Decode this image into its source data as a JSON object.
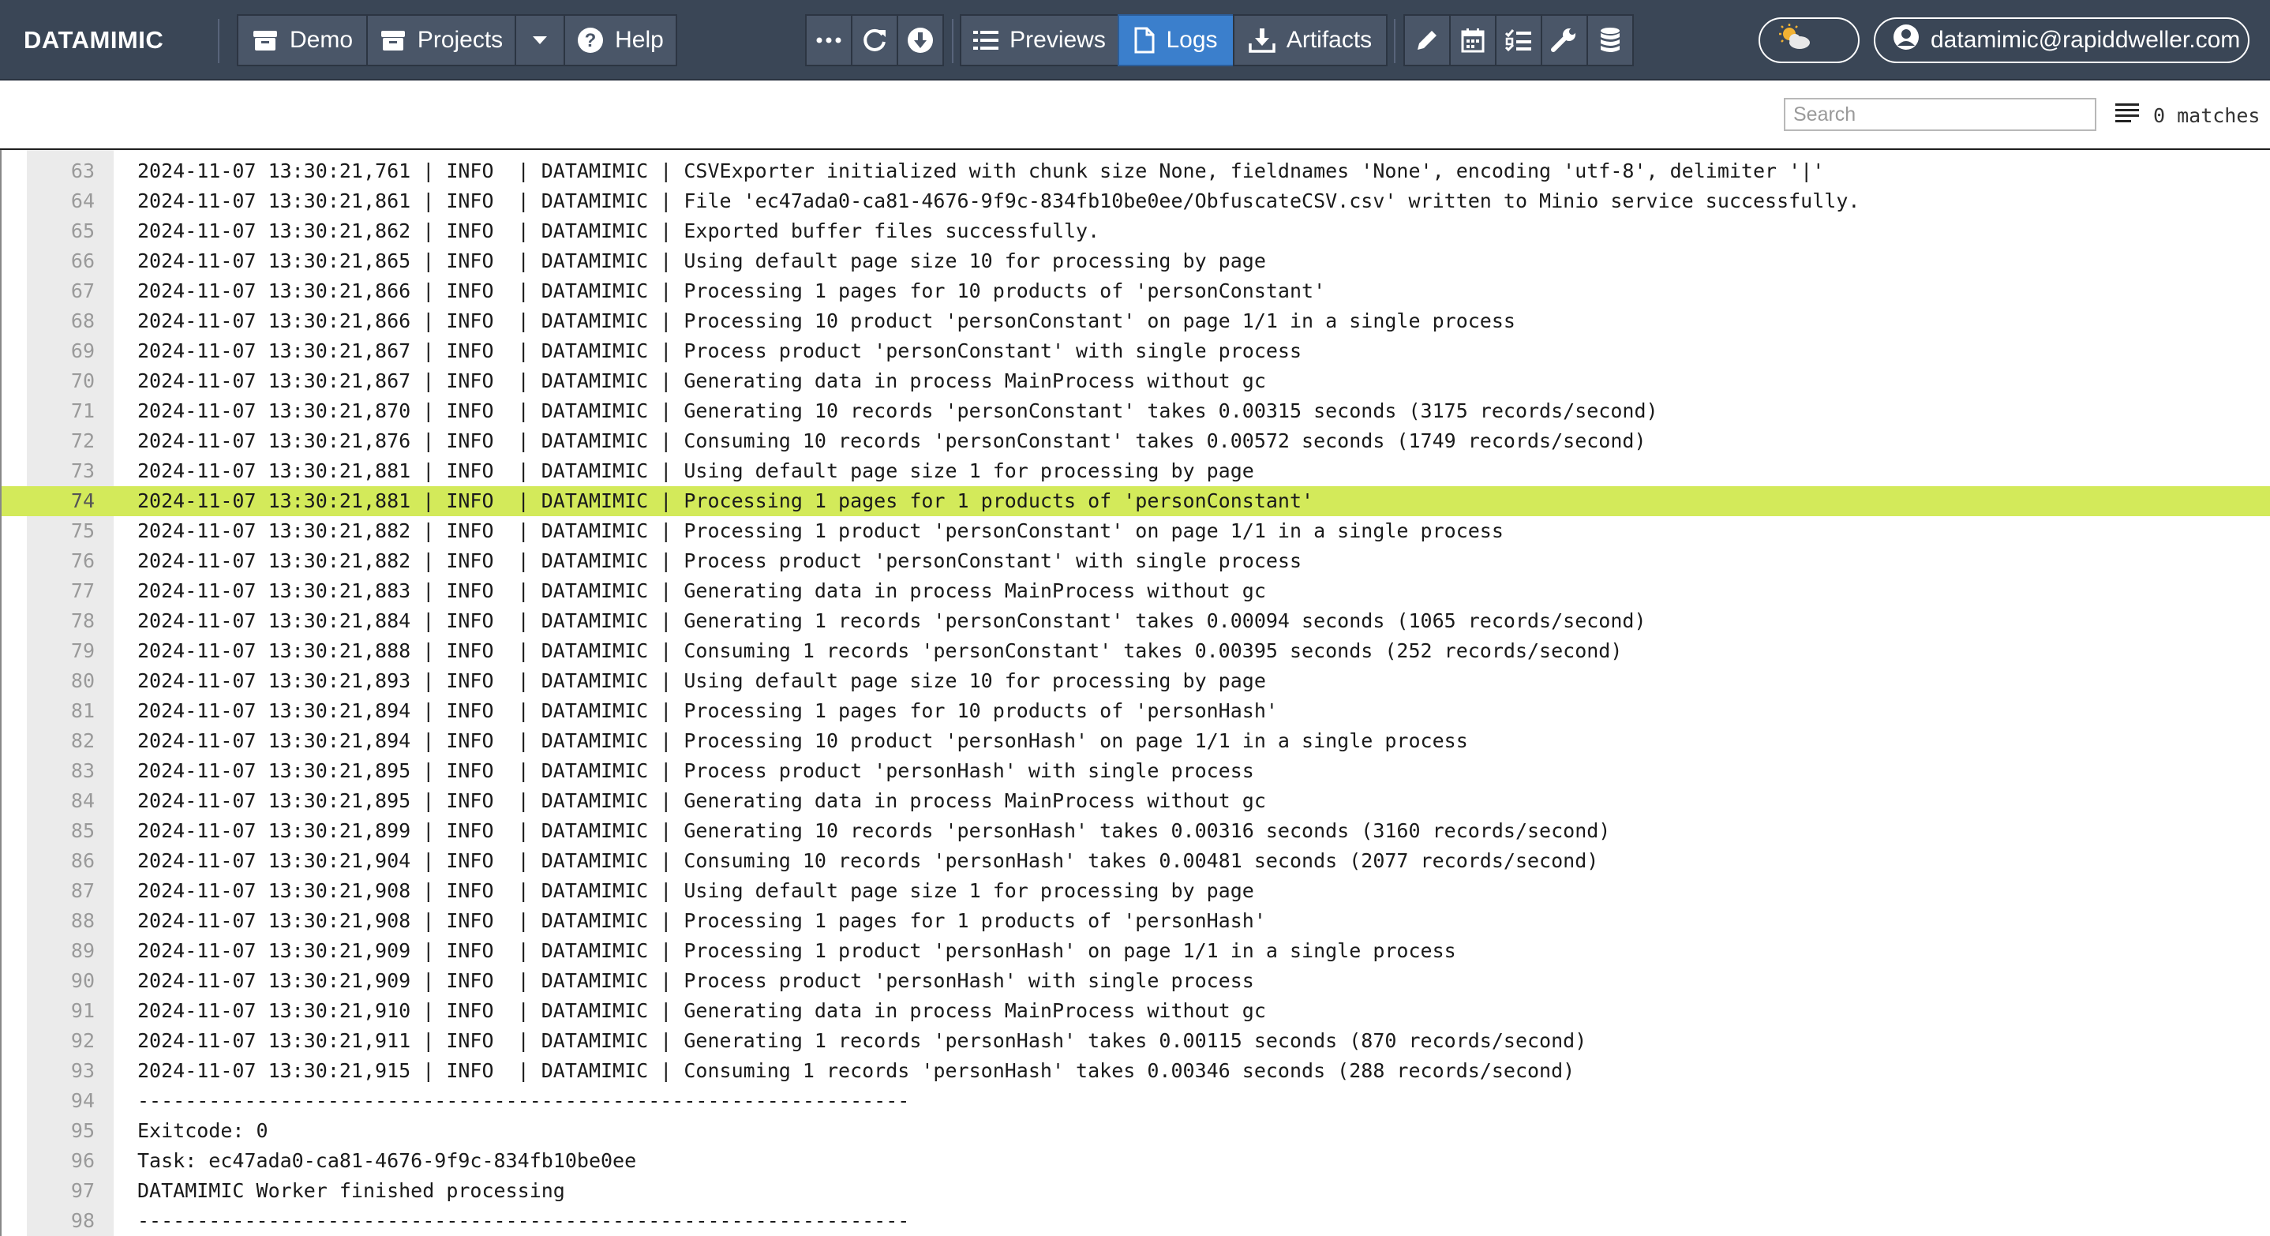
{
  "navbar": {
    "brand": "DATAMIMIC",
    "demo_label": "Demo",
    "projects_label": "Projects",
    "help_label": "Help",
    "previews_label": "Previews",
    "logs_label": "Logs",
    "artifacts_label": "Artifacts",
    "user_email": "datamimic@rapiddweller.com",
    "active_tab": "Logs",
    "accent_color": "#3b7fcc",
    "navbar_color": "#3a4656"
  },
  "search": {
    "placeholder": "Search",
    "value": "",
    "matches_text": "0 matches"
  },
  "log": {
    "highlight_color": "#d3ea5a",
    "highlighted_line": 74,
    "lines": [
      {
        "n": "63",
        "text": "2024-11-07 13:30:21,761 | INFO  | DATAMIMIC | CSVExporter initialized with chunk size None, fieldnames 'None', encoding 'utf-8', delimiter '|'"
      },
      {
        "n": "64",
        "text": "2024-11-07 13:30:21,861 | INFO  | DATAMIMIC | File 'ec47ada0-ca81-4676-9f9c-834fb10be0ee/ObfuscateCSV.csv' written to Minio service successfully."
      },
      {
        "n": "65",
        "text": "2024-11-07 13:30:21,862 | INFO  | DATAMIMIC | Exported buffer files successfully."
      },
      {
        "n": "66",
        "text": "2024-11-07 13:30:21,865 | INFO  | DATAMIMIC | Using default page size 10 for processing by page"
      },
      {
        "n": "67",
        "text": "2024-11-07 13:30:21,866 | INFO  | DATAMIMIC | Processing 1 pages for 10 products of 'personConstant'"
      },
      {
        "n": "68",
        "text": "2024-11-07 13:30:21,866 | INFO  | DATAMIMIC | Processing 10 product 'personConstant' on page 1/1 in a single process"
      },
      {
        "n": "69",
        "text": "2024-11-07 13:30:21,867 | INFO  | DATAMIMIC | Process product 'personConstant' with single process"
      },
      {
        "n": "70",
        "text": "2024-11-07 13:30:21,867 | INFO  | DATAMIMIC | Generating data in process MainProcess without gc"
      },
      {
        "n": "71",
        "text": "2024-11-07 13:30:21,870 | INFO  | DATAMIMIC | Generating 10 records 'personConstant' takes 0.00315 seconds (3175 records/second)"
      },
      {
        "n": "72",
        "text": "2024-11-07 13:30:21,876 | INFO  | DATAMIMIC | Consuming 10 records 'personConstant' takes 0.00572 seconds (1749 records/second)"
      },
      {
        "n": "73",
        "text": "2024-11-07 13:30:21,881 | INFO  | DATAMIMIC | Using default page size 1 for processing by page"
      },
      {
        "n": "74",
        "text": "2024-11-07 13:30:21,881 | INFO  | DATAMIMIC | Processing 1 pages for 1 products of 'personConstant'"
      },
      {
        "n": "75",
        "text": "2024-11-07 13:30:21,882 | INFO  | DATAMIMIC | Processing 1 product 'personConstant' on page 1/1 in a single process"
      },
      {
        "n": "76",
        "text": "2024-11-07 13:30:21,882 | INFO  | DATAMIMIC | Process product 'personConstant' with single process"
      },
      {
        "n": "77",
        "text": "2024-11-07 13:30:21,883 | INFO  | DATAMIMIC | Generating data in process MainProcess without gc"
      },
      {
        "n": "78",
        "text": "2024-11-07 13:30:21,884 | INFO  | DATAMIMIC | Generating 1 records 'personConstant' takes 0.00094 seconds (1065 records/second)"
      },
      {
        "n": "79",
        "text": "2024-11-07 13:30:21,888 | INFO  | DATAMIMIC | Consuming 1 records 'personConstant' takes 0.00395 seconds (252 records/second)"
      },
      {
        "n": "80",
        "text": "2024-11-07 13:30:21,893 | INFO  | DATAMIMIC | Using default page size 10 for processing by page"
      },
      {
        "n": "81",
        "text": "2024-11-07 13:30:21,894 | INFO  | DATAMIMIC | Processing 1 pages for 10 products of 'personHash'"
      },
      {
        "n": "82",
        "text": "2024-11-07 13:30:21,894 | INFO  | DATAMIMIC | Processing 10 product 'personHash' on page 1/1 in a single process"
      },
      {
        "n": "83",
        "text": "2024-11-07 13:30:21,895 | INFO  | DATAMIMIC | Process product 'personHash' with single process"
      },
      {
        "n": "84",
        "text": "2024-11-07 13:30:21,895 | INFO  | DATAMIMIC | Generating data in process MainProcess without gc"
      },
      {
        "n": "85",
        "text": "2024-11-07 13:30:21,899 | INFO  | DATAMIMIC | Generating 10 records 'personHash' takes 0.00316 seconds (3160 records/second)"
      },
      {
        "n": "86",
        "text": "2024-11-07 13:30:21,904 | INFO  | DATAMIMIC | Consuming 10 records 'personHash' takes 0.00481 seconds (2077 records/second)"
      },
      {
        "n": "87",
        "text": "2024-11-07 13:30:21,908 | INFO  | DATAMIMIC | Using default page size 1 for processing by page"
      },
      {
        "n": "88",
        "text": "2024-11-07 13:30:21,908 | INFO  | DATAMIMIC | Processing 1 pages for 1 products of 'personHash'"
      },
      {
        "n": "89",
        "text": "2024-11-07 13:30:21,909 | INFO  | DATAMIMIC | Processing 1 product 'personHash' on page 1/1 in a single process"
      },
      {
        "n": "90",
        "text": "2024-11-07 13:30:21,909 | INFO  | DATAMIMIC | Process product 'personHash' with single process"
      },
      {
        "n": "91",
        "text": "2024-11-07 13:30:21,910 | INFO  | DATAMIMIC | Generating data in process MainProcess without gc"
      },
      {
        "n": "92",
        "text": "2024-11-07 13:30:21,911 | INFO  | DATAMIMIC | Generating 1 records 'personHash' takes 0.00115 seconds (870 records/second)"
      },
      {
        "n": "93",
        "text": "2024-11-07 13:30:21,915 | INFO  | DATAMIMIC | Consuming 1 records 'personHash' takes 0.00346 seconds (288 records/second)"
      },
      {
        "n": "94",
        "text": "-----------------------------------------------------------------"
      },
      {
        "n": "95",
        "text": "Exitcode: 0"
      },
      {
        "n": "96",
        "text": "Task: ec47ada0-ca81-4676-9f9c-834fb10be0ee"
      },
      {
        "n": "97",
        "text": "DATAMIMIC Worker finished processing"
      },
      {
        "n": "98",
        "text": "-----------------------------------------------------------------"
      }
    ]
  }
}
